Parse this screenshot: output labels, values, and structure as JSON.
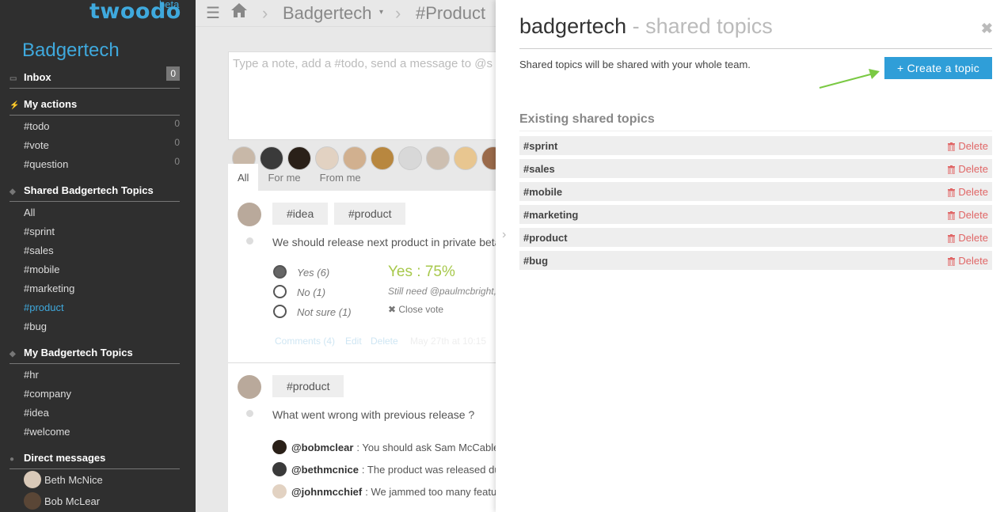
{
  "app": {
    "logo": "twoodo",
    "logo_badge": "beta",
    "team": "Badgertech"
  },
  "sidebar": {
    "inbox": {
      "label": "Inbox",
      "count": "0"
    },
    "my_actions": {
      "label": "My actions",
      "items": [
        {
          "label": "#todo",
          "count": "0"
        },
        {
          "label": "#vote",
          "count": "0"
        },
        {
          "label": "#question",
          "count": "0"
        }
      ]
    },
    "shared": {
      "label": "Shared Badgertech Topics",
      "items": [
        "All",
        "#sprint",
        "#sales",
        "#mobile",
        "#marketing",
        "#product",
        "#bug"
      ],
      "active": "#product"
    },
    "mine": {
      "label": "My Badgertech Topics",
      "items": [
        "#hr",
        "#company",
        "#idea",
        "#welcome"
      ]
    },
    "dm": {
      "label": "Direct messages",
      "items": [
        "Beth McNice",
        "Bob McLear"
      ]
    }
  },
  "topbar": {
    "crumb_team": "Badgertech",
    "crumb_topic": "#Product"
  },
  "main": {
    "note_placeholder": "Type a note, add a #todo, send a message to @s",
    "tabs": [
      "All",
      "For me",
      "From me"
    ],
    "post1": {
      "tags": [
        "#idea",
        "#product"
      ],
      "text": "We should release next product in private beta",
      "options": [
        "Yes (6)",
        "No (1)",
        "Not sure (1)"
      ],
      "result": "Yes : 75%",
      "still_need": "Still need @paulmcbright, @",
      "close_vote": "Close vote",
      "meta": {
        "comments": "Comments (4)",
        "edit": "Edit",
        "delete": "Delete",
        "date": "May 27th at 10:15"
      }
    },
    "post2": {
      "tags": [
        "#product"
      ],
      "text": "What went wrong with previous release ?",
      "comments": [
        {
          "who": "@bobmclear",
          "text": ": You should ask Sam McCable"
        },
        {
          "who": "@bethmcnice",
          "text": ": The product was released du"
        },
        {
          "who": "@johnmcchief",
          "text": ": We jammed too many featu"
        }
      ]
    }
  },
  "panel": {
    "title": "badgertech",
    "title_sub": "- shared topics",
    "description": "Shared topics will be shared with your whole team.",
    "create_label": "+ Create a topic",
    "existing_label": "Existing shared topics",
    "delete_label": "Delete",
    "topics": [
      "#sprint",
      "#sales",
      "#mobile",
      "#marketing",
      "#product",
      "#bug"
    ]
  },
  "colors": {
    "accent": "#2f9ed8",
    "sidebar": "#2f2f2f",
    "delete": "#e06666",
    "vote_yes": "#a7c84b",
    "arrow": "#7ac943"
  }
}
